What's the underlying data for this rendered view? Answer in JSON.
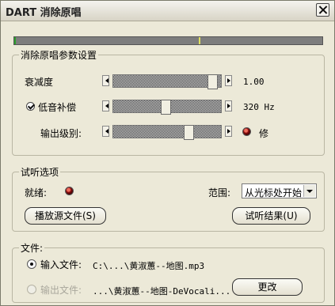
{
  "window": {
    "title": "DART 消除原唱"
  },
  "meter": {
    "level": 0.005,
    "peak": 0.6
  },
  "params": {
    "title": "消除原唱参数设置",
    "attenuation": {
      "label": "衰减度",
      "value": "1.00",
      "position": 0.97
    },
    "bass": {
      "label": "低音补偿",
      "checked": true,
      "value": "320 Hz",
      "position": 0.49
    },
    "output": {
      "label": "输出级别:",
      "position": 0.72,
      "repair_label": "修"
    }
  },
  "audition": {
    "title": "试听选项",
    "ready_label": "就绪:",
    "range_label": "范围:",
    "range_value": "从光标处开始",
    "play_source_label": "播放源文件(S)",
    "play_result_label": "试听结果(U)"
  },
  "files": {
    "title": "文件:",
    "input_label": "输入文件:",
    "input_path": "C:\\...\\黄淑蕙--地图.mp3",
    "output_label": "输出文件:",
    "output_path": "...\\黄淑蕙--地图-DeVocali...",
    "change_label": "更改"
  }
}
